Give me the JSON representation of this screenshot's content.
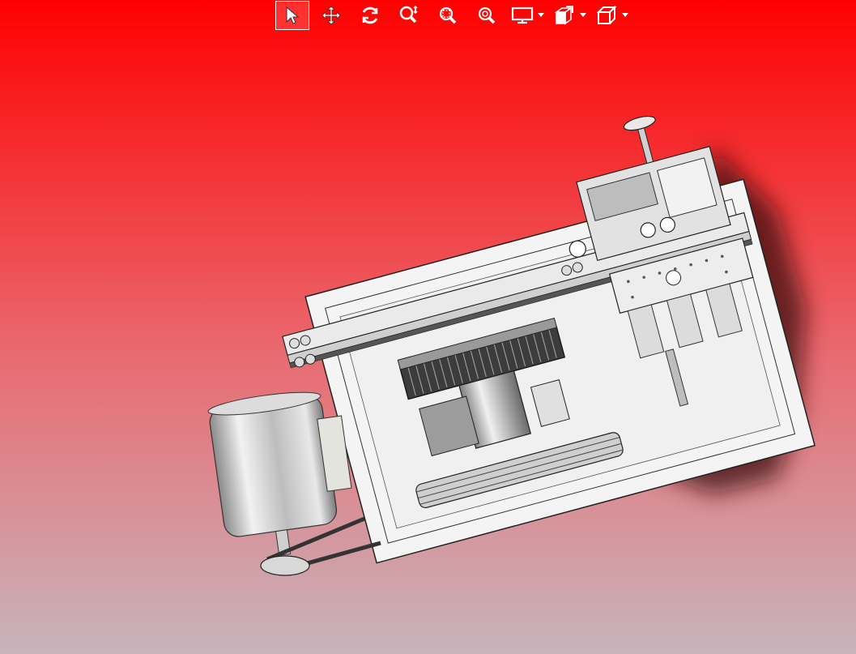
{
  "viewport": {
    "background_top": "#ff0000",
    "background_bottom": "#c8b4bc",
    "shadow_color": "#1a0a0a"
  },
  "toolbar": {
    "items": [
      {
        "icon": "select-arrow-icon",
        "active": true
      },
      {
        "icon": "pan-icon",
        "active": false
      },
      {
        "icon": "rotate-icon",
        "active": false
      },
      {
        "icon": "zoom-icon",
        "active": false
      },
      {
        "icon": "zoom-window-icon",
        "active": false
      },
      {
        "icon": "zoom-fit-icon",
        "active": false
      },
      {
        "icon": "display-mode-icon",
        "active": false,
        "dropdown": true
      },
      {
        "icon": "section-view-icon",
        "active": false,
        "dropdown": true
      },
      {
        "icon": "view-orientation-icon",
        "active": false,
        "dropdown": true
      }
    ]
  },
  "model": {
    "description_colors": {
      "body": "#e6e6e6",
      "steel": "#c8c8c8",
      "dark": "#555555"
    }
  }
}
